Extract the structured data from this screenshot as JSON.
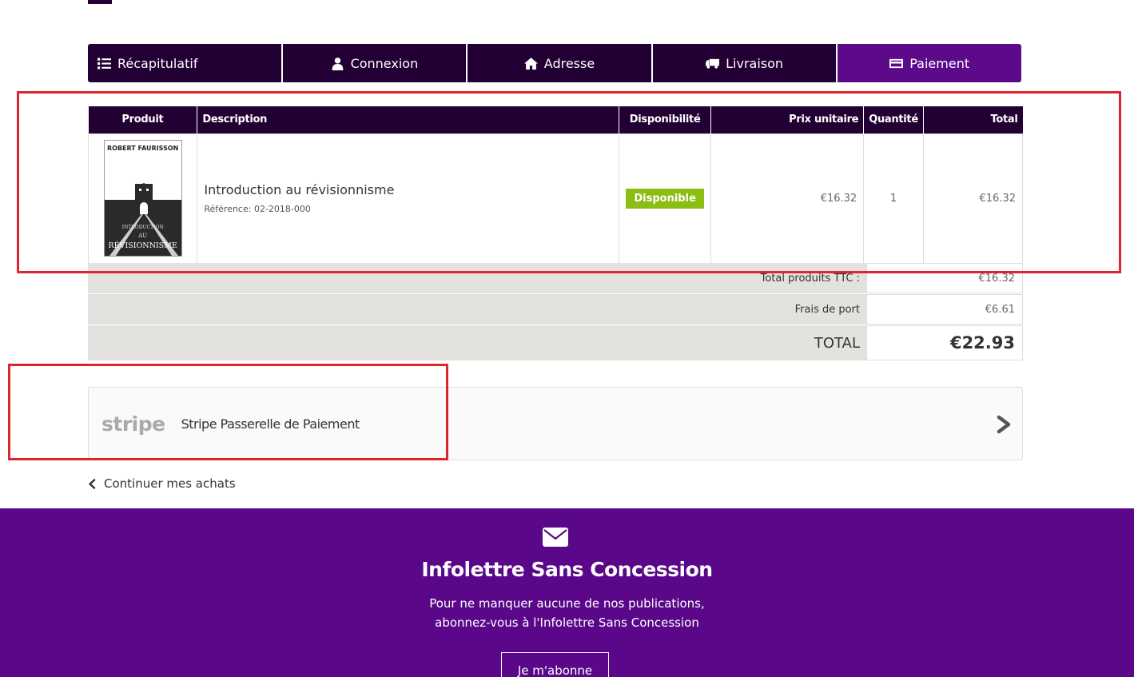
{
  "steps": [
    {
      "label": "Récapitulatif",
      "icon": "list-icon"
    },
    {
      "label": "Connexion",
      "icon": "user-icon"
    },
    {
      "label": "Adresse",
      "icon": "home-icon"
    },
    {
      "label": "Livraison",
      "icon": "truck-icon"
    },
    {
      "label": "Paiement",
      "icon": "credit-card-icon",
      "active": true
    }
  ],
  "cart": {
    "headers": {
      "product": "Produit",
      "description": "Description",
      "availability": "Disponibilité",
      "unit_price": "Prix unitaire",
      "quantity": "Quantité",
      "total": "Total"
    },
    "item": {
      "cover_author": "ROBERT FAURISSON",
      "cover_title_1": "INTRODUCTION",
      "cover_title_2": "AU",
      "cover_title_3": "RÉVISIONNISME",
      "name": "Introduction au révisionnisme",
      "reference": "Référence: 02-2018-000",
      "availability": "Disponible",
      "unit_price": "€16.32",
      "quantity": "1",
      "total": "€16.32"
    }
  },
  "totals": {
    "products_label": "Total produits TTC :",
    "products_value": "€16.32",
    "shipping_label": "Frais de port",
    "shipping_value": "€6.61",
    "total_label": "TOTAL",
    "total_value": "€22.93"
  },
  "payment": {
    "logo": "stripe",
    "label": "Stripe Passerelle de Paiement"
  },
  "continue_label": "Continuer mes achats",
  "newsletter": {
    "title": "Infolettre Sans Concession",
    "line1": "Pour ne manquer aucune de nos publications,",
    "line2": "abonnez-vous à l'Infolettre Sans Concession",
    "button": "Je m'abonne"
  },
  "colors": {
    "brand_dark": "#220033",
    "brand_purple": "#5c0a8a",
    "available_green": "#8cbd12",
    "highlight_red": "#e0242c"
  }
}
